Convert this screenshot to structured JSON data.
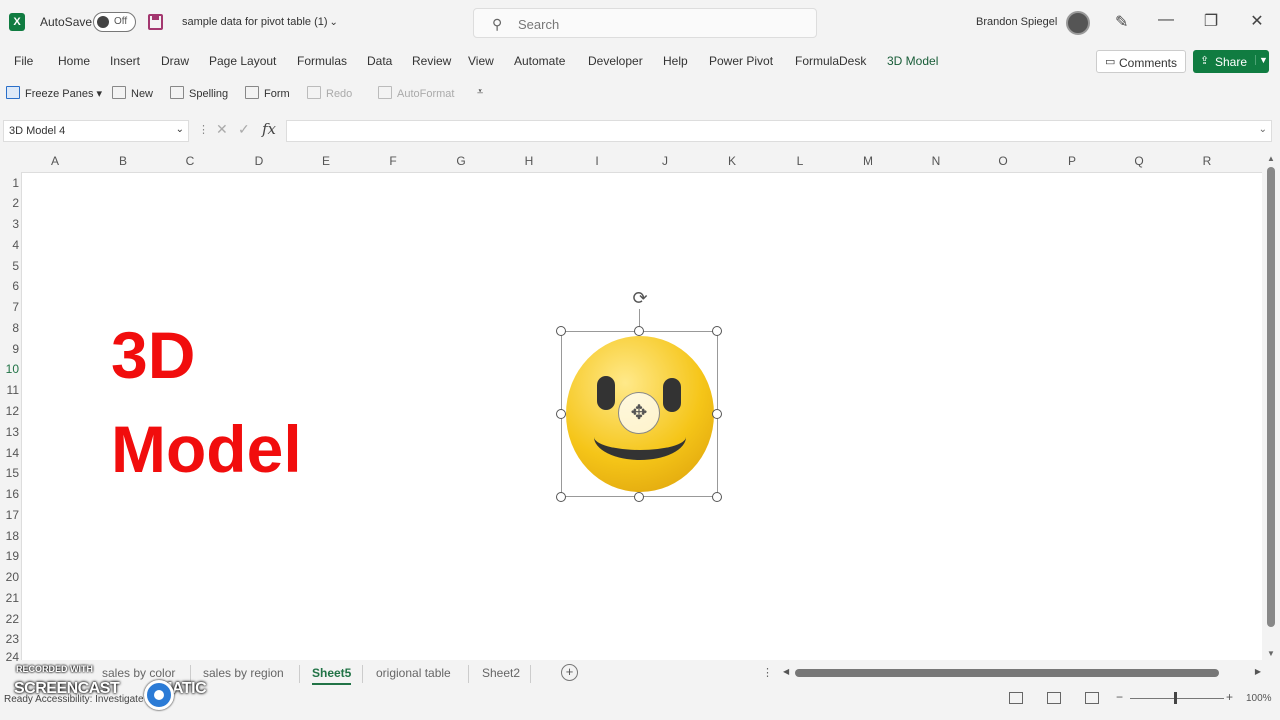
{
  "titlebar": {
    "app_logo": "X",
    "autosave_label": "AutoSave",
    "autosave_state": "Off",
    "doc_title": "sample data for pivot table (1)",
    "search_placeholder": "Search",
    "user_name": "Brandon Spiegel",
    "icons": [
      "excel-logo-icon",
      "save-icon",
      "search-icon",
      "pen-icon",
      "minimize-icon",
      "restore-icon",
      "close-icon"
    ]
  },
  "ribbon_tabs": [
    "File",
    "Home",
    "Insert",
    "Draw",
    "Page Layout",
    "Formulas",
    "Data",
    "Review",
    "View",
    "Automate",
    "Developer",
    "Help",
    "Power Pivot",
    "FormulaDesk",
    "3D Model"
  ],
  "active_tab": "3D Model",
  "comments_label": "Comments",
  "share_label": "Share",
  "toolbar": {
    "freeze_panes": "Freeze Panes",
    "new": "New",
    "spelling": "Spelling",
    "form": "Form",
    "redo": "Redo",
    "autoformat": "AutoFormat"
  },
  "formula_bar": {
    "name_box": "3D Model 4",
    "fx": "fx",
    "value": ""
  },
  "columns": [
    "A",
    "B",
    "C",
    "D",
    "E",
    "F",
    "G",
    "H",
    "I",
    "J",
    "K",
    "L",
    "M",
    "N",
    "O",
    "P",
    "Q",
    "R"
  ],
  "rows": [
    "1",
    "2",
    "3",
    "4",
    "5",
    "6",
    "7",
    "8",
    "9",
    "10",
    "11",
    "12",
    "13",
    "14",
    "15",
    "16",
    "17",
    "18",
    "19",
    "20",
    "21",
    "22",
    "23",
    "24"
  ],
  "selected_row": "10",
  "slide_title": {
    "line1": "3D",
    "line2": "Model"
  },
  "sheet_tabs": [
    "sales by color",
    "sales by region",
    "Sheet5",
    "origional table",
    "Sheet2"
  ],
  "active_sheet": "Sheet5",
  "status": {
    "text": "Ready   Accessibility: Investigate",
    "zoom": "100%"
  },
  "watermark": {
    "top": "RECORDED WITH",
    "main": "SCREENCAST",
    "suffix": "MATIC"
  },
  "colors": {
    "accent_green": "#107c41",
    "title_red": "#f10d0d"
  }
}
